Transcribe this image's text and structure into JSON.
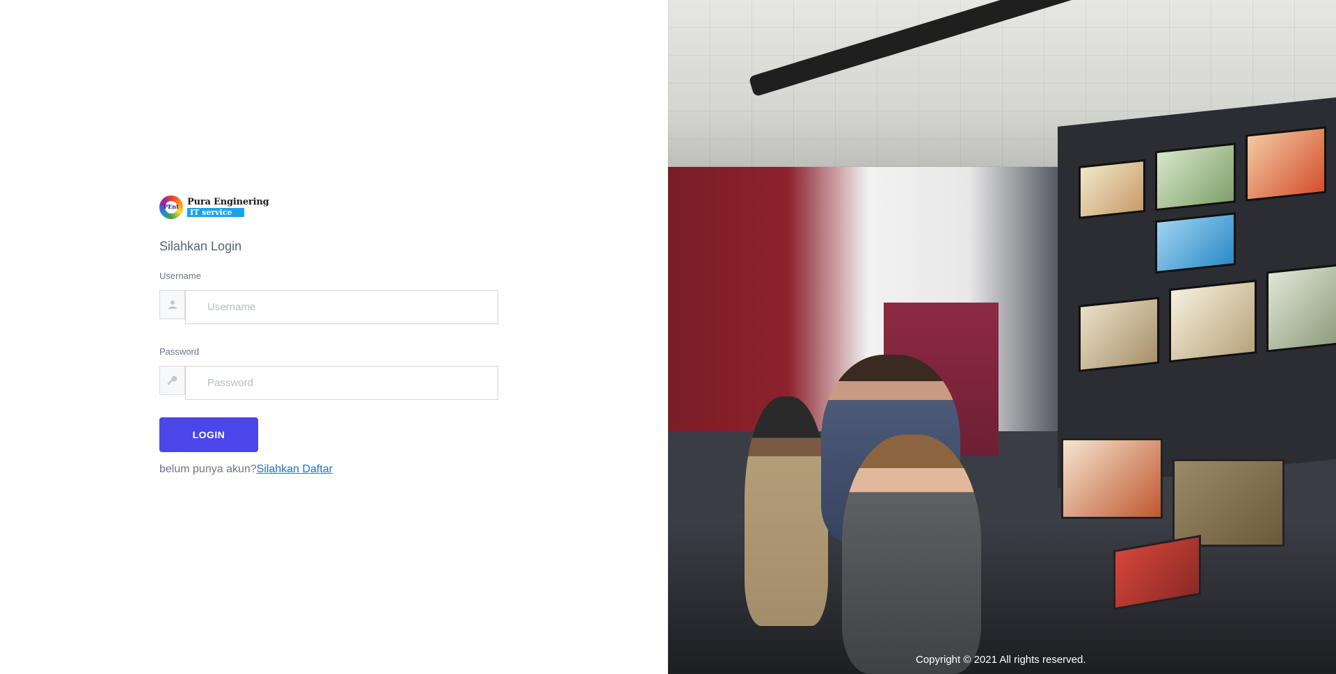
{
  "brand": {
    "logo_mark": "PEnt",
    "name": "Pura Enginering",
    "tagline": "IT service"
  },
  "login": {
    "title": "Silahkan Login",
    "username": {
      "label": "Username",
      "placeholder": "Username",
      "icon": "user-icon"
    },
    "password": {
      "label": "Password",
      "placeholder": "Password",
      "icon": "key-icon"
    },
    "button_label": "LOGIN",
    "register_prompt": "belum punya akun?",
    "register_link": "Silahkan Daftar"
  },
  "footer": {
    "copyright": "Copyright © 2021 All rights reserved."
  },
  "colors": {
    "primary_button": "#4a46e9",
    "link": "#1d6fd8",
    "logo_badge": "#1aa3e8"
  }
}
